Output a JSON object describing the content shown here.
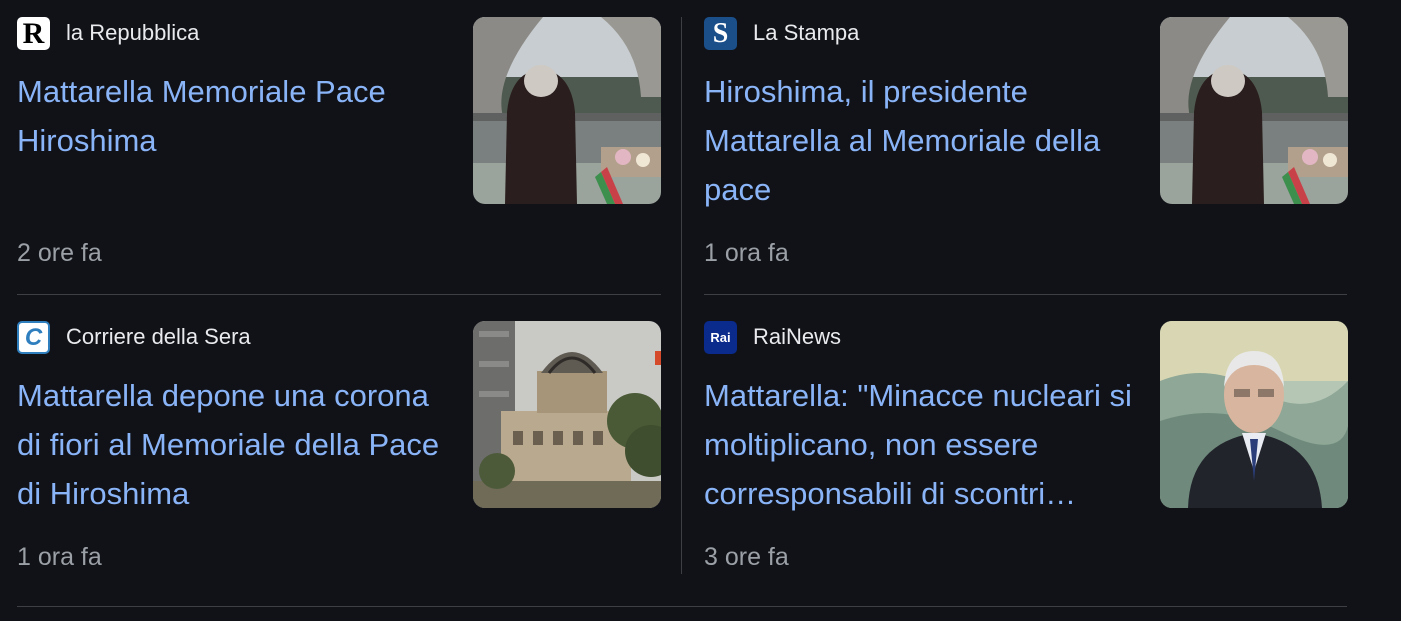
{
  "articles": [
    {
      "source": "la Repubblica",
      "logo_glyph": "R",
      "logo_icon": "repubblica-logo-icon",
      "title": "Mattarella Memoriale Pace Hiroshima",
      "time": "2 ore fa",
      "thumb_icon": "memorial-arch-photo"
    },
    {
      "source": "La Stampa",
      "logo_glyph": "S",
      "logo_icon": "stampa-logo-icon",
      "title": "Hiroshima, il presidente Mattarella al Memoriale della pace",
      "time": "1 ora fa",
      "thumb_icon": "memorial-arch-photo"
    },
    {
      "source": "Corriere della Sera",
      "logo_glyph": "C",
      "logo_icon": "corriere-logo-icon",
      "title": "Mattarella depone una corona di fiori al Memoriale della Pace di Hiroshima",
      "time": "1 ora fa",
      "thumb_icon": "atomic-dome-photo"
    },
    {
      "source": "RaiNews",
      "logo_glyph": "Rai",
      "logo_icon": "rai-logo-icon",
      "title": "Mattarella: \"Minacce nucleari si moltiplicano, non essere corresponsabili di scontri…",
      "time": "3 ore fa",
      "thumb_icon": "portrait-photo"
    }
  ],
  "colors": {
    "background": "#111217",
    "link": "#8ab4f8",
    "source_text": "#e8eaed",
    "meta_text": "#9aa0a6",
    "divider": "#3c4043"
  }
}
